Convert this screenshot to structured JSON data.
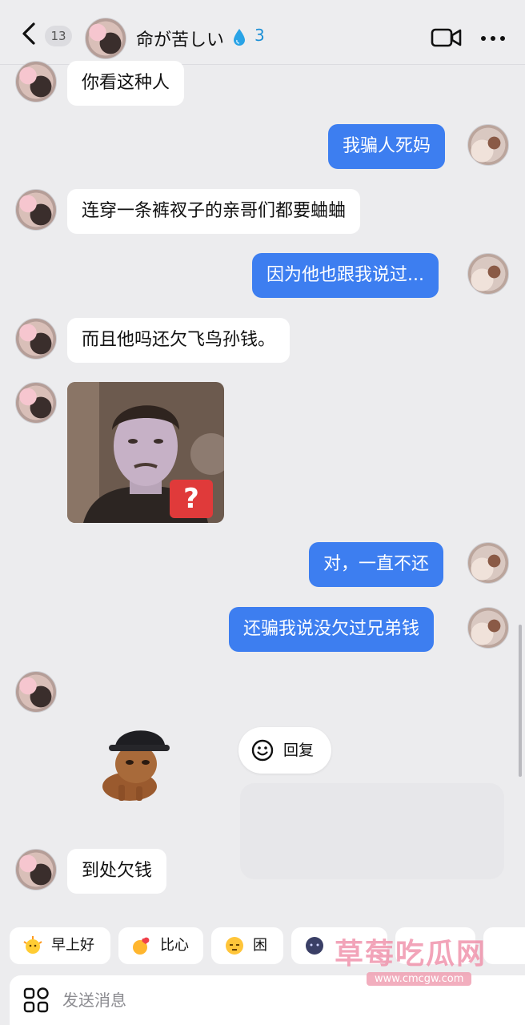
{
  "header": {
    "unread_count": "13",
    "chat_name": "命が苦しい",
    "spark_count": "3",
    "icons": {
      "back": "back-chevron-icon",
      "spark": "water-drop-icon",
      "video": "video-call-icon",
      "more": "more-dots-icon"
    }
  },
  "messages": [
    {
      "side": "in",
      "text": "你看这种人"
    },
    {
      "side": "out",
      "text": "我骗人死妈"
    },
    {
      "side": "in",
      "text": "连穿一条裤衩子的亲哥们都要蛐蛐"
    },
    {
      "side": "out",
      "text": "因为他也跟我说过..."
    },
    {
      "side": "in",
      "text": "而且他吗还欠飞鸟孙钱。"
    },
    {
      "side": "in",
      "type": "image",
      "badge": "?"
    },
    {
      "side": "out",
      "text": "对，一直不还"
    },
    {
      "side": "out",
      "text": "还骗我说没欠过兄弟钱"
    },
    {
      "side": "in",
      "type": "sticker"
    },
    {
      "side": "in",
      "text": "到处欠钱"
    }
  ],
  "reply_action": {
    "label": "回复",
    "icon": "smiley-icon"
  },
  "quick_replies": [
    {
      "label": "早上好",
      "icon": "sun-face-icon"
    },
    {
      "label": "比心",
      "icon": "heart-hand-icon"
    },
    {
      "label": "困",
      "icon": "sleepy-face-icon"
    },
    {
      "label": "",
      "icon": "dark-face-icon"
    }
  ],
  "composer": {
    "placeholder": "发送消息",
    "icon": "apps-grid-icon"
  },
  "watermark": {
    "title": "草莓吃瓜网",
    "url": "www.cmcgw.com"
  },
  "colors": {
    "outgoing_bubble": "#3d7ef0",
    "incoming_bubble": "#ffffff",
    "background": "#ececee",
    "spark": "#1e90d6"
  }
}
